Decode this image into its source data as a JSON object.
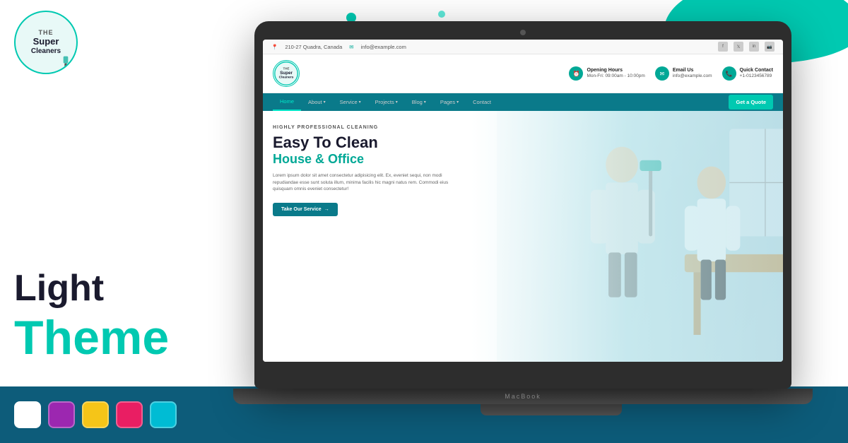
{
  "logo": {
    "the": "THE",
    "super": "Super",
    "cleaners": "Cleaners",
    "alt": "Super Cleaners Logo"
  },
  "left_panel": {
    "light_label": "Light",
    "theme_label": "Theme"
  },
  "topbar": {
    "address": "210-27 Quadra, Canada",
    "email": "info@example.com",
    "socials": [
      "f",
      "𝕏",
      "in",
      "📷"
    ]
  },
  "header": {
    "opening_hours_label": "Opening Hours",
    "opening_hours_value": "Mon-Fri: 09:00am - 10:00pm",
    "email_label": "Email Us",
    "email_value": "info@example.com",
    "quick_contact_label": "Quick Contact",
    "quick_contact_value": "+1-0123456789"
  },
  "nav": {
    "items": [
      {
        "label": "Home",
        "active": true,
        "has_dropdown": false
      },
      {
        "label": "About",
        "active": false,
        "has_dropdown": true
      },
      {
        "label": "Service",
        "active": false,
        "has_dropdown": true
      },
      {
        "label": "Projects",
        "active": false,
        "has_dropdown": true
      },
      {
        "label": "Blog",
        "active": false,
        "has_dropdown": true
      },
      {
        "label": "Pages",
        "active": false,
        "has_dropdown": true
      },
      {
        "label": "Contact",
        "active": false,
        "has_dropdown": false
      }
    ],
    "cta_label": "Get a Quote"
  },
  "hero": {
    "subtitle": "HIGHLY PROFESSIONAL CLEANING",
    "title_main": "Easy To Clean",
    "title_sub": "House & Office",
    "description": "Lorem ipsum dolor sit amet consectetur adipisicing elit. Ex, eveniet sequi, non modi repudiandae esse sunt soluta illum, minima facilis hic magni natus rem. Commodi eius quisquam omnis eveniet consectetur!",
    "cta_label": "Take Our Service",
    "cta_arrow": "→"
  },
  "swatches": [
    {
      "color": "#ffffff",
      "label": "white"
    },
    {
      "color": "#9c27b0",
      "label": "purple"
    },
    {
      "color": "#f5c518",
      "label": "yellow"
    },
    {
      "color": "#e91e63",
      "label": "pink"
    },
    {
      "color": "#00bcd4",
      "label": "cyan"
    }
  ],
  "macbook_label": "MacBook"
}
